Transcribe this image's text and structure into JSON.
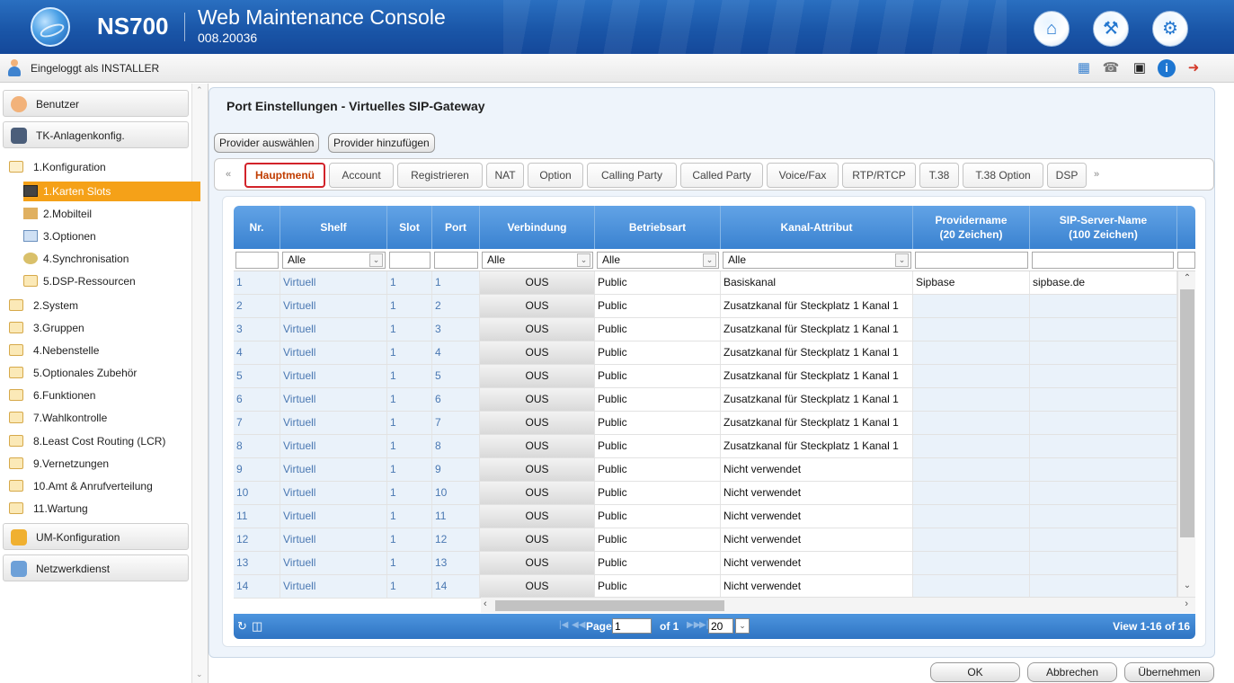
{
  "header": {
    "product": "NS700",
    "title": "Web Maintenance Console",
    "version": "008.20036"
  },
  "userbar": {
    "logged_in": "Eingeloggt als INSTALLER"
  },
  "sidebar": {
    "sections": [
      {
        "label": "Benutzer"
      },
      {
        "label": "TK-Anlagenkonfig."
      },
      {
        "label": "UM-Konfiguration"
      },
      {
        "label": "Netzwerkdienst"
      }
    ],
    "items": [
      {
        "label": "1.Konfiguration"
      },
      {
        "label": "2.System"
      },
      {
        "label": "3.Gruppen"
      },
      {
        "label": "4.Nebenstelle"
      },
      {
        "label": "5.Optionales Zubehör"
      },
      {
        "label": "6.Funktionen"
      },
      {
        "label": "7.Wahlkontrolle"
      },
      {
        "label": "8.Least Cost Routing (LCR)"
      },
      {
        "label": "9.Vernetzungen"
      },
      {
        "label": "10.Amt & Anrufverteilung"
      },
      {
        "label": "11.Wartung"
      }
    ],
    "subitems": [
      {
        "label": "1.Karten Slots",
        "active": true
      },
      {
        "label": "2.Mobilteil"
      },
      {
        "label": "3.Optionen"
      },
      {
        "label": "4.Synchronisation"
      },
      {
        "label": "5.DSP-Ressourcen"
      }
    ]
  },
  "main": {
    "title": "Port Einstellungen - Virtuelles SIP-Gateway",
    "buttons": {
      "select_provider": "Provider auswählen",
      "add_provider": "Provider hinzufügen"
    },
    "tabs": [
      "Hauptmenü",
      "Account",
      "Registrieren",
      "NAT",
      "Option",
      "Calling Party",
      "Called Party",
      "Voice/Fax",
      "RTP/RTCP",
      "T.38",
      "T.38 Option",
      "DSP"
    ],
    "active_tab": "Hauptmenü",
    "tab_prev": "«",
    "tab_next": "»"
  },
  "grid": {
    "columns": [
      "Nr.",
      "Shelf",
      "Slot",
      "Port",
      "Verbindung",
      "Betriebsart",
      "Kanal-Attribut",
      "Providername\n(20 Zeichen)",
      "SIP-Server-Name\n(100 Zeichen)"
    ],
    "filters": {
      "shelf": "Alle",
      "verbindung": "Alle",
      "betriebsart": "Alle",
      "kanal": "Alle"
    },
    "rows": [
      {
        "nr": "1",
        "shelf": "Virtuell",
        "slot": "1",
        "port": "1",
        "verbindung": "OUS",
        "betriebsart": "Public",
        "kanal": "Basiskanal",
        "provider": "Sipbase",
        "server": "sipbase.de"
      },
      {
        "nr": "2",
        "shelf": "Virtuell",
        "slot": "1",
        "port": "2",
        "verbindung": "OUS",
        "betriebsart": "Public",
        "kanal": "Zusatzkanal für Steckplatz 1 Kanal 1",
        "provider": "",
        "server": ""
      },
      {
        "nr": "3",
        "shelf": "Virtuell",
        "slot": "1",
        "port": "3",
        "verbindung": "OUS",
        "betriebsart": "Public",
        "kanal": "Zusatzkanal für Steckplatz 1 Kanal 1",
        "provider": "",
        "server": ""
      },
      {
        "nr": "4",
        "shelf": "Virtuell",
        "slot": "1",
        "port": "4",
        "verbindung": "OUS",
        "betriebsart": "Public",
        "kanal": "Zusatzkanal für Steckplatz 1 Kanal 1",
        "provider": "",
        "server": ""
      },
      {
        "nr": "5",
        "shelf": "Virtuell",
        "slot": "1",
        "port": "5",
        "verbindung": "OUS",
        "betriebsart": "Public",
        "kanal": "Zusatzkanal für Steckplatz 1 Kanal 1",
        "provider": "",
        "server": ""
      },
      {
        "nr": "6",
        "shelf": "Virtuell",
        "slot": "1",
        "port": "6",
        "verbindung": "OUS",
        "betriebsart": "Public",
        "kanal": "Zusatzkanal für Steckplatz 1 Kanal 1",
        "provider": "",
        "server": ""
      },
      {
        "nr": "7",
        "shelf": "Virtuell",
        "slot": "1",
        "port": "7",
        "verbindung": "OUS",
        "betriebsart": "Public",
        "kanal": "Zusatzkanal für Steckplatz 1 Kanal 1",
        "provider": "",
        "server": ""
      },
      {
        "nr": "8",
        "shelf": "Virtuell",
        "slot": "1",
        "port": "8",
        "verbindung": "OUS",
        "betriebsart": "Public",
        "kanal": "Zusatzkanal für Steckplatz 1 Kanal 1",
        "provider": "",
        "server": ""
      },
      {
        "nr": "9",
        "shelf": "Virtuell",
        "slot": "1",
        "port": "9",
        "verbindung": "OUS",
        "betriebsart": "Public",
        "kanal": "Nicht verwendet",
        "provider": "",
        "server": ""
      },
      {
        "nr": "10",
        "shelf": "Virtuell",
        "slot": "1",
        "port": "10",
        "verbindung": "OUS",
        "betriebsart": "Public",
        "kanal": "Nicht verwendet",
        "provider": "",
        "server": ""
      },
      {
        "nr": "11",
        "shelf": "Virtuell",
        "slot": "1",
        "port": "11",
        "verbindung": "OUS",
        "betriebsart": "Public",
        "kanal": "Nicht verwendet",
        "provider": "",
        "server": ""
      },
      {
        "nr": "12",
        "shelf": "Virtuell",
        "slot": "1",
        "port": "12",
        "verbindung": "OUS",
        "betriebsart": "Public",
        "kanal": "Nicht verwendet",
        "provider": "",
        "server": ""
      },
      {
        "nr": "13",
        "shelf": "Virtuell",
        "slot": "1",
        "port": "13",
        "verbindung": "OUS",
        "betriebsart": "Public",
        "kanal": "Nicht verwendet",
        "provider": "",
        "server": ""
      },
      {
        "nr": "14",
        "shelf": "Virtuell",
        "slot": "1",
        "port": "14",
        "verbindung": "OUS",
        "betriebsart": "Public",
        "kanal": "Nicht verwendet",
        "provider": "",
        "server": ""
      }
    ]
  },
  "pager": {
    "page_label": "Page",
    "page": "1",
    "of_label": "of 1",
    "page_size": "20",
    "view": "View 1-16 of 16"
  },
  "footer": {
    "ok": "OK",
    "cancel": "Abbrechen",
    "apply": "Übernehmen"
  },
  "colors": {
    "header_blue": "#1a56a8",
    "grid_header_blue": "#3a82d0",
    "active_sidebar": "#f5a118",
    "active_tab_border": "#d2232a"
  },
  "icons": [
    "home-icon",
    "wrench-icon",
    "settings-icon",
    "calendar-icon",
    "phone-icon",
    "save-icon",
    "info-icon",
    "logout-icon",
    "refresh-icon",
    "copy-icon"
  ]
}
